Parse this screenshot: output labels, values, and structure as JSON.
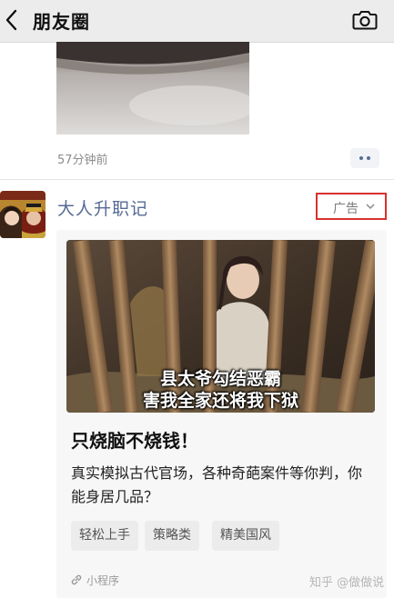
{
  "header": {
    "title": "朋友圈",
    "back_icon": "chevron-left-icon",
    "camera_icon": "camera-icon"
  },
  "previous_post": {
    "time": "57分钟前",
    "more_icon": "more-dots-icon",
    "accent_color": "#576b95"
  },
  "ad_post": {
    "name": "大人升职记",
    "ad_label": "广告",
    "ad_chevron_icon": "chevron-down-icon",
    "highlight_color": "#d9312b",
    "image_caption_line1": "县太爷勾结恶霸",
    "image_caption_line2": "害我全家还将我下狱",
    "headline": "只烧脑不烧钱！",
    "description": "真实模拟古代官场，各种奇葩案件等你判，你能身居几品？",
    "tags": [
      "轻松上手",
      "策略类",
      "精美国风"
    ],
    "source_icon": "link-icon",
    "source_label": "小程序"
  },
  "watermark": "知乎 @做做说"
}
